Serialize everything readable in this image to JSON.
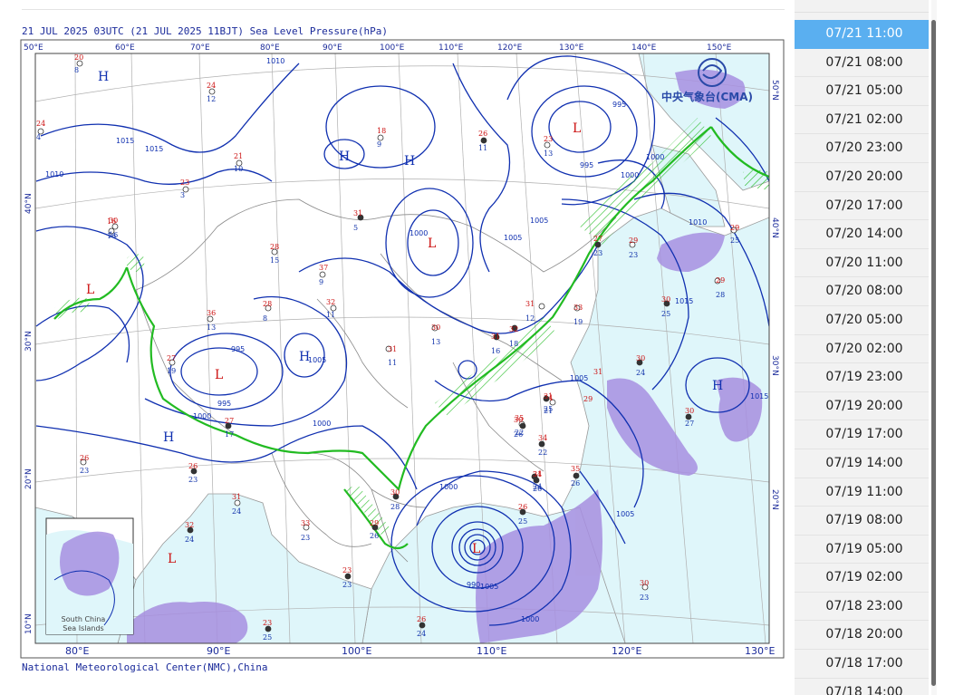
{
  "map": {
    "title": "21 JUL 2025 03UTC  (21 JUL 2025 11BJT) Sea Level Pressure(hPa)",
    "footer": "National Meteorological Center(NMC),China",
    "cma_logo_text": "中央气象台(CMA)",
    "inset_label_line1": "South China",
    "inset_label_line2": "Sea Islands",
    "top_lon_labels": [
      "50°E",
      "60°E",
      "70°E",
      "80°E",
      "90°E",
      "100°E",
      "110°E",
      "120°E",
      "130°E",
      "140°E",
      "150°E"
    ],
    "bottom_lon_labels": [
      "80°E",
      "90°E",
      "100°E",
      "110°E",
      "120°E",
      "130°E"
    ],
    "left_lat_labels": [
      "40°N",
      "30°N",
      "20°N",
      "10°N"
    ],
    "right_lat_labels": [
      "50°N",
      "40°N",
      "30°N",
      "20°N"
    ],
    "pressure_centers": [
      {
        "symbol": "H"
      },
      {
        "symbol": "H"
      },
      {
        "symbol": "H"
      },
      {
        "symbol": "L"
      },
      {
        "symbol": "L"
      },
      {
        "symbol": "L"
      },
      {
        "symbol": "L"
      },
      {
        "symbol": "H"
      },
      {
        "symbol": "H"
      },
      {
        "symbol": "L"
      },
      {
        "symbol": "H"
      },
      {
        "symbol": "L"
      }
    ],
    "isobar_labels": [
      "1015",
      "1015",
      "1010",
      "1010",
      "1005",
      "1000",
      "1000",
      "1000",
      "1005",
      "995",
      "995",
      "1000",
      "1000",
      "995",
      "1000",
      "1010",
      "1015",
      "1015",
      "1005",
      "1005",
      "995",
      "990",
      "1005",
      "1000",
      "1000",
      "1005"
    ],
    "station_temps": [
      "20",
      "24",
      "24",
      "16",
      "21",
      "23",
      "18",
      "26",
      "23",
      "30",
      "28",
      "36",
      "37",
      "31",
      "32",
      "28",
      "27",
      "27",
      "31",
      "30",
      "31",
      "31",
      "32",
      "33",
      "34",
      "35",
      "34",
      "27",
      "29",
      "30",
      "30",
      "30",
      "29",
      "29",
      "31",
      "30",
      "31",
      "26",
      "26",
      "31",
      "32",
      "33",
      "23",
      "23",
      "26",
      "30",
      "29",
      "26",
      "34",
      "30",
      "35",
      "29",
      "31"
    ],
    "station_dews": [
      "8",
      "12",
      "4",
      "16",
      "10",
      "3",
      "9",
      "11",
      "13",
      "16",
      "15",
      "13",
      "9",
      "5",
      "11",
      "8",
      "19",
      "17",
      "11",
      "13",
      "16",
      "12",
      "18",
      "19",
      "21",
      "22",
      "22",
      "23",
      "23",
      "25",
      "24",
      "27",
      "28",
      "25",
      "25",
      "26",
      "26",
      "23",
      "23",
      "24",
      "24",
      "23",
      "23",
      "25",
      "24",
      "28",
      "26",
      "25",
      "24",
      "23",
      "26"
    ],
    "colors": {
      "land": "#ffffff",
      "sea": "#dff6fa",
      "isobar": "#1030b0",
      "front": "#22bb22",
      "precip": "#a78fe0",
      "temp_text": "#cc1111",
      "dew_text": "#1133aa",
      "border": "#888888"
    }
  },
  "sidebar": {
    "times": [
      "07/21 11:00",
      "07/21 08:00",
      "07/21 05:00",
      "07/21 02:00",
      "07/20 23:00",
      "07/20 20:00",
      "07/20 17:00",
      "07/20 14:00",
      "07/20 11:00",
      "07/20 08:00",
      "07/20 05:00",
      "07/20 02:00",
      "07/19 23:00",
      "07/19 20:00",
      "07/19 17:00",
      "07/19 14:00",
      "07/19 11:00",
      "07/19 08:00",
      "07/19 05:00",
      "07/19 02:00",
      "07/18 23:00",
      "07/18 20:00",
      "07/18 17:00",
      "07/18 14:00"
    ],
    "active_index": 0
  }
}
